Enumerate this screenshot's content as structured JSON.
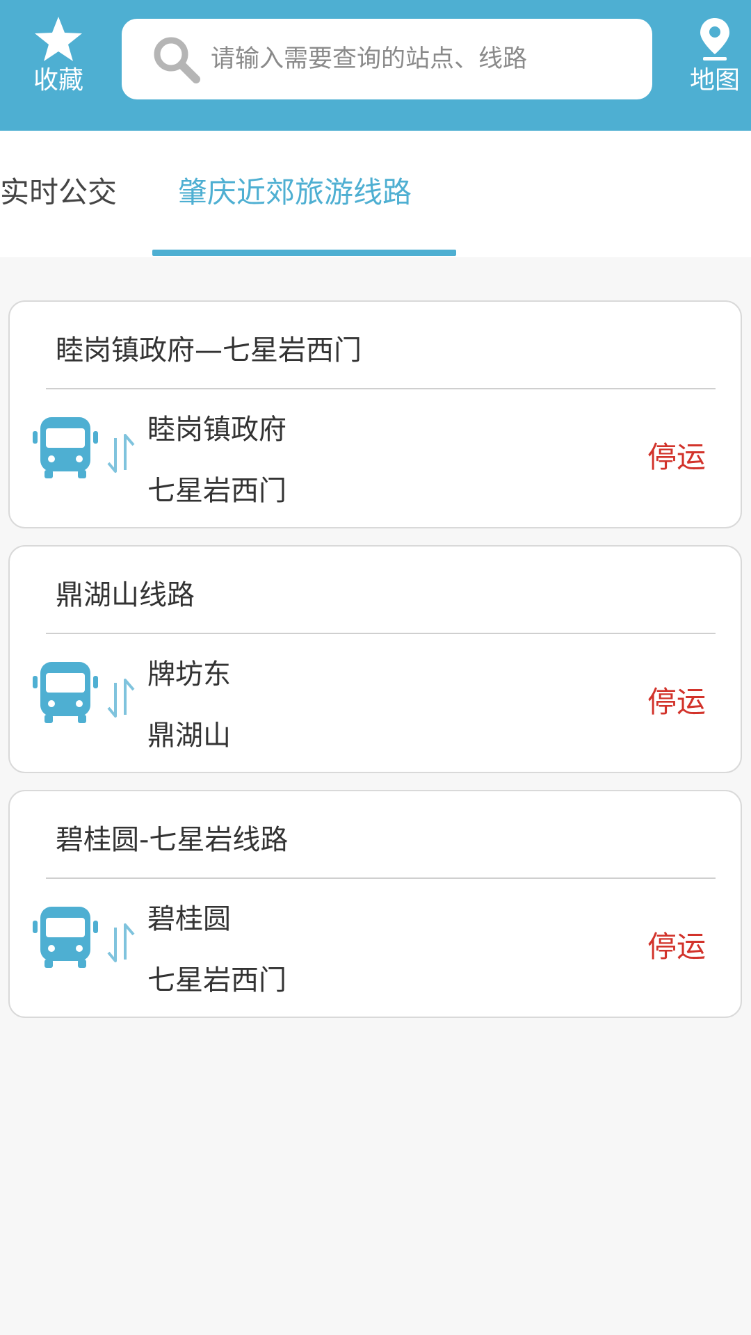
{
  "header": {
    "favorites_label": "收藏",
    "map_label": "地图",
    "search_placeholder": "请输入需要查询的站点、线路",
    "accent_color": "#4eafd2"
  },
  "tabs": [
    {
      "label": "实时公交",
      "active": false
    },
    {
      "label": "肇庆近郊旅游线路",
      "active": true
    }
  ],
  "routes": [
    {
      "title": "睦岗镇政府—七星岩西门",
      "from": "睦岗镇政府",
      "to": "七星岩西门",
      "status": "停运",
      "icon": "bus-icon"
    },
    {
      "title": "鼎湖山线路",
      "from": "牌坊东",
      "to": "鼎湖山",
      "status": "停运",
      "icon": "bus-icon"
    },
    {
      "title": "碧桂圆-七星岩线路",
      "from": "碧桂圆",
      "to": "七星岩西门",
      "status": "停运",
      "icon": "bus-icon"
    }
  ],
  "status_color": "#d2332b"
}
